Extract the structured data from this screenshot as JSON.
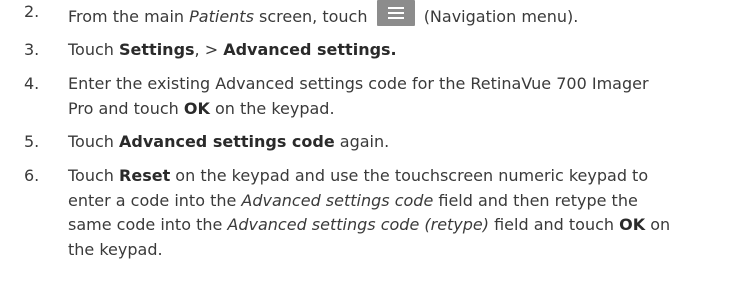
{
  "steps": [
    {
      "number": "2.",
      "parts": [
        "From the main ",
        "Patients",
        " screen, touch",
        "(Navigation menu)."
      ],
      "icon": "hamburger-menu-icon"
    },
    {
      "number": "3.",
      "parts": [
        "Touch ",
        "Settings",
        ", > ",
        "Advanced settings."
      ]
    },
    {
      "number": "4.",
      "parts": [
        "Enter the existing Advanced settings code for the RetinaVue 700 Imager",
        "Pro and touch ",
        "OK",
        " on the keypad."
      ]
    },
    {
      "number": "5.",
      "parts": [
        "Touch ",
        "Advanced settings code",
        " again."
      ]
    },
    {
      "number": "6.",
      "parts": [
        "Touch ",
        "Reset",
        " on the keypad and use the touchscreen numeric keypad to",
        "enter a code into the ",
        "Advanced settings code",
        " field and then retype the",
        "same code into the ",
        "Advanced settings code (retype)",
        " field and touch ",
        "OK",
        " on",
        "the keypad."
      ]
    }
  ]
}
